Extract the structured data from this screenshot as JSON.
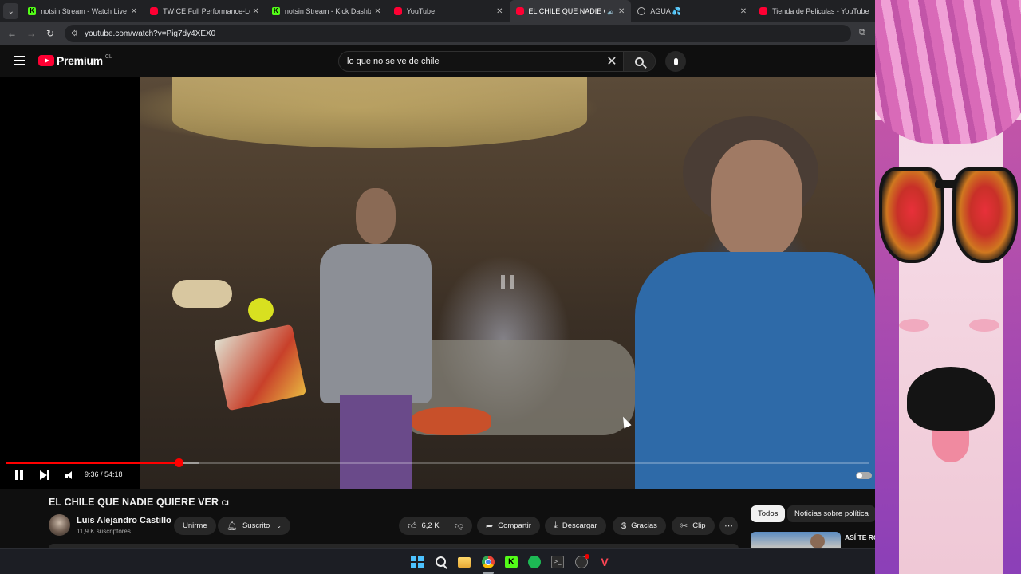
{
  "browser": {
    "tabs": [
      {
        "title": "notsin Stream - Watch Live on Kick",
        "favicon": "kick-icon",
        "active": false
      },
      {
        "title": "TWICE Full Performance-Lollapalooza",
        "favicon": "youtube-icon",
        "active": false
      },
      {
        "title": "notsin Stream - Kick Dashboard",
        "favicon": "kick-icon",
        "active": false
      },
      {
        "title": "YouTube",
        "favicon": "youtube-icon",
        "active": false
      },
      {
        "title": "EL CHILE QUE NADIE QUIERE VER",
        "favicon": "youtube-icon",
        "active": true,
        "audio": true
      },
      {
        "title": "AGUA 💦",
        "favicon": "globe-icon",
        "active": false
      },
      {
        "title": "Tienda de Peliculas - YouTube",
        "favicon": "youtube-icon",
        "active": false
      }
    ],
    "url": "youtube.com/watch?v=Pig7dy4XEX0"
  },
  "youtube": {
    "logo_text": "Premium",
    "country_code": "CL",
    "search_query": "lo que no se ve de chile"
  },
  "player": {
    "time_current": "9:36",
    "time_total": "54:18",
    "time_display": "9:36 / 54:18",
    "progress_fraction": 0.2,
    "buffered_fraction": 0.224
  },
  "video": {
    "title": "EL CHILE QUE NADIE QUIERE VER",
    "title_flag": "CL",
    "channel_name": "Luis Alejandro Castillo",
    "subscribers": "11,9 K suscriptores",
    "join_label": "Unirme",
    "subscribed_label": "Suscrito",
    "likes": "6,2 K",
    "share_label": "Compartir",
    "download_label": "Descargar",
    "thanks_label": "Gracias",
    "clip_label": "Clip"
  },
  "sidebar": {
    "chips": [
      "Todos",
      "Noticias sobre política"
    ],
    "recommendation_title": "ASÍ TE RO"
  },
  "taskbar": {
    "apps": [
      "windows-start",
      "search",
      "file-explorer",
      "chrome",
      "kick",
      "spotify",
      "terminal",
      "obs",
      "valorant"
    ]
  },
  "colors": {
    "accent_red": "#ff0033",
    "kick_green": "#53fc18",
    "background": "#0f0f0f"
  }
}
